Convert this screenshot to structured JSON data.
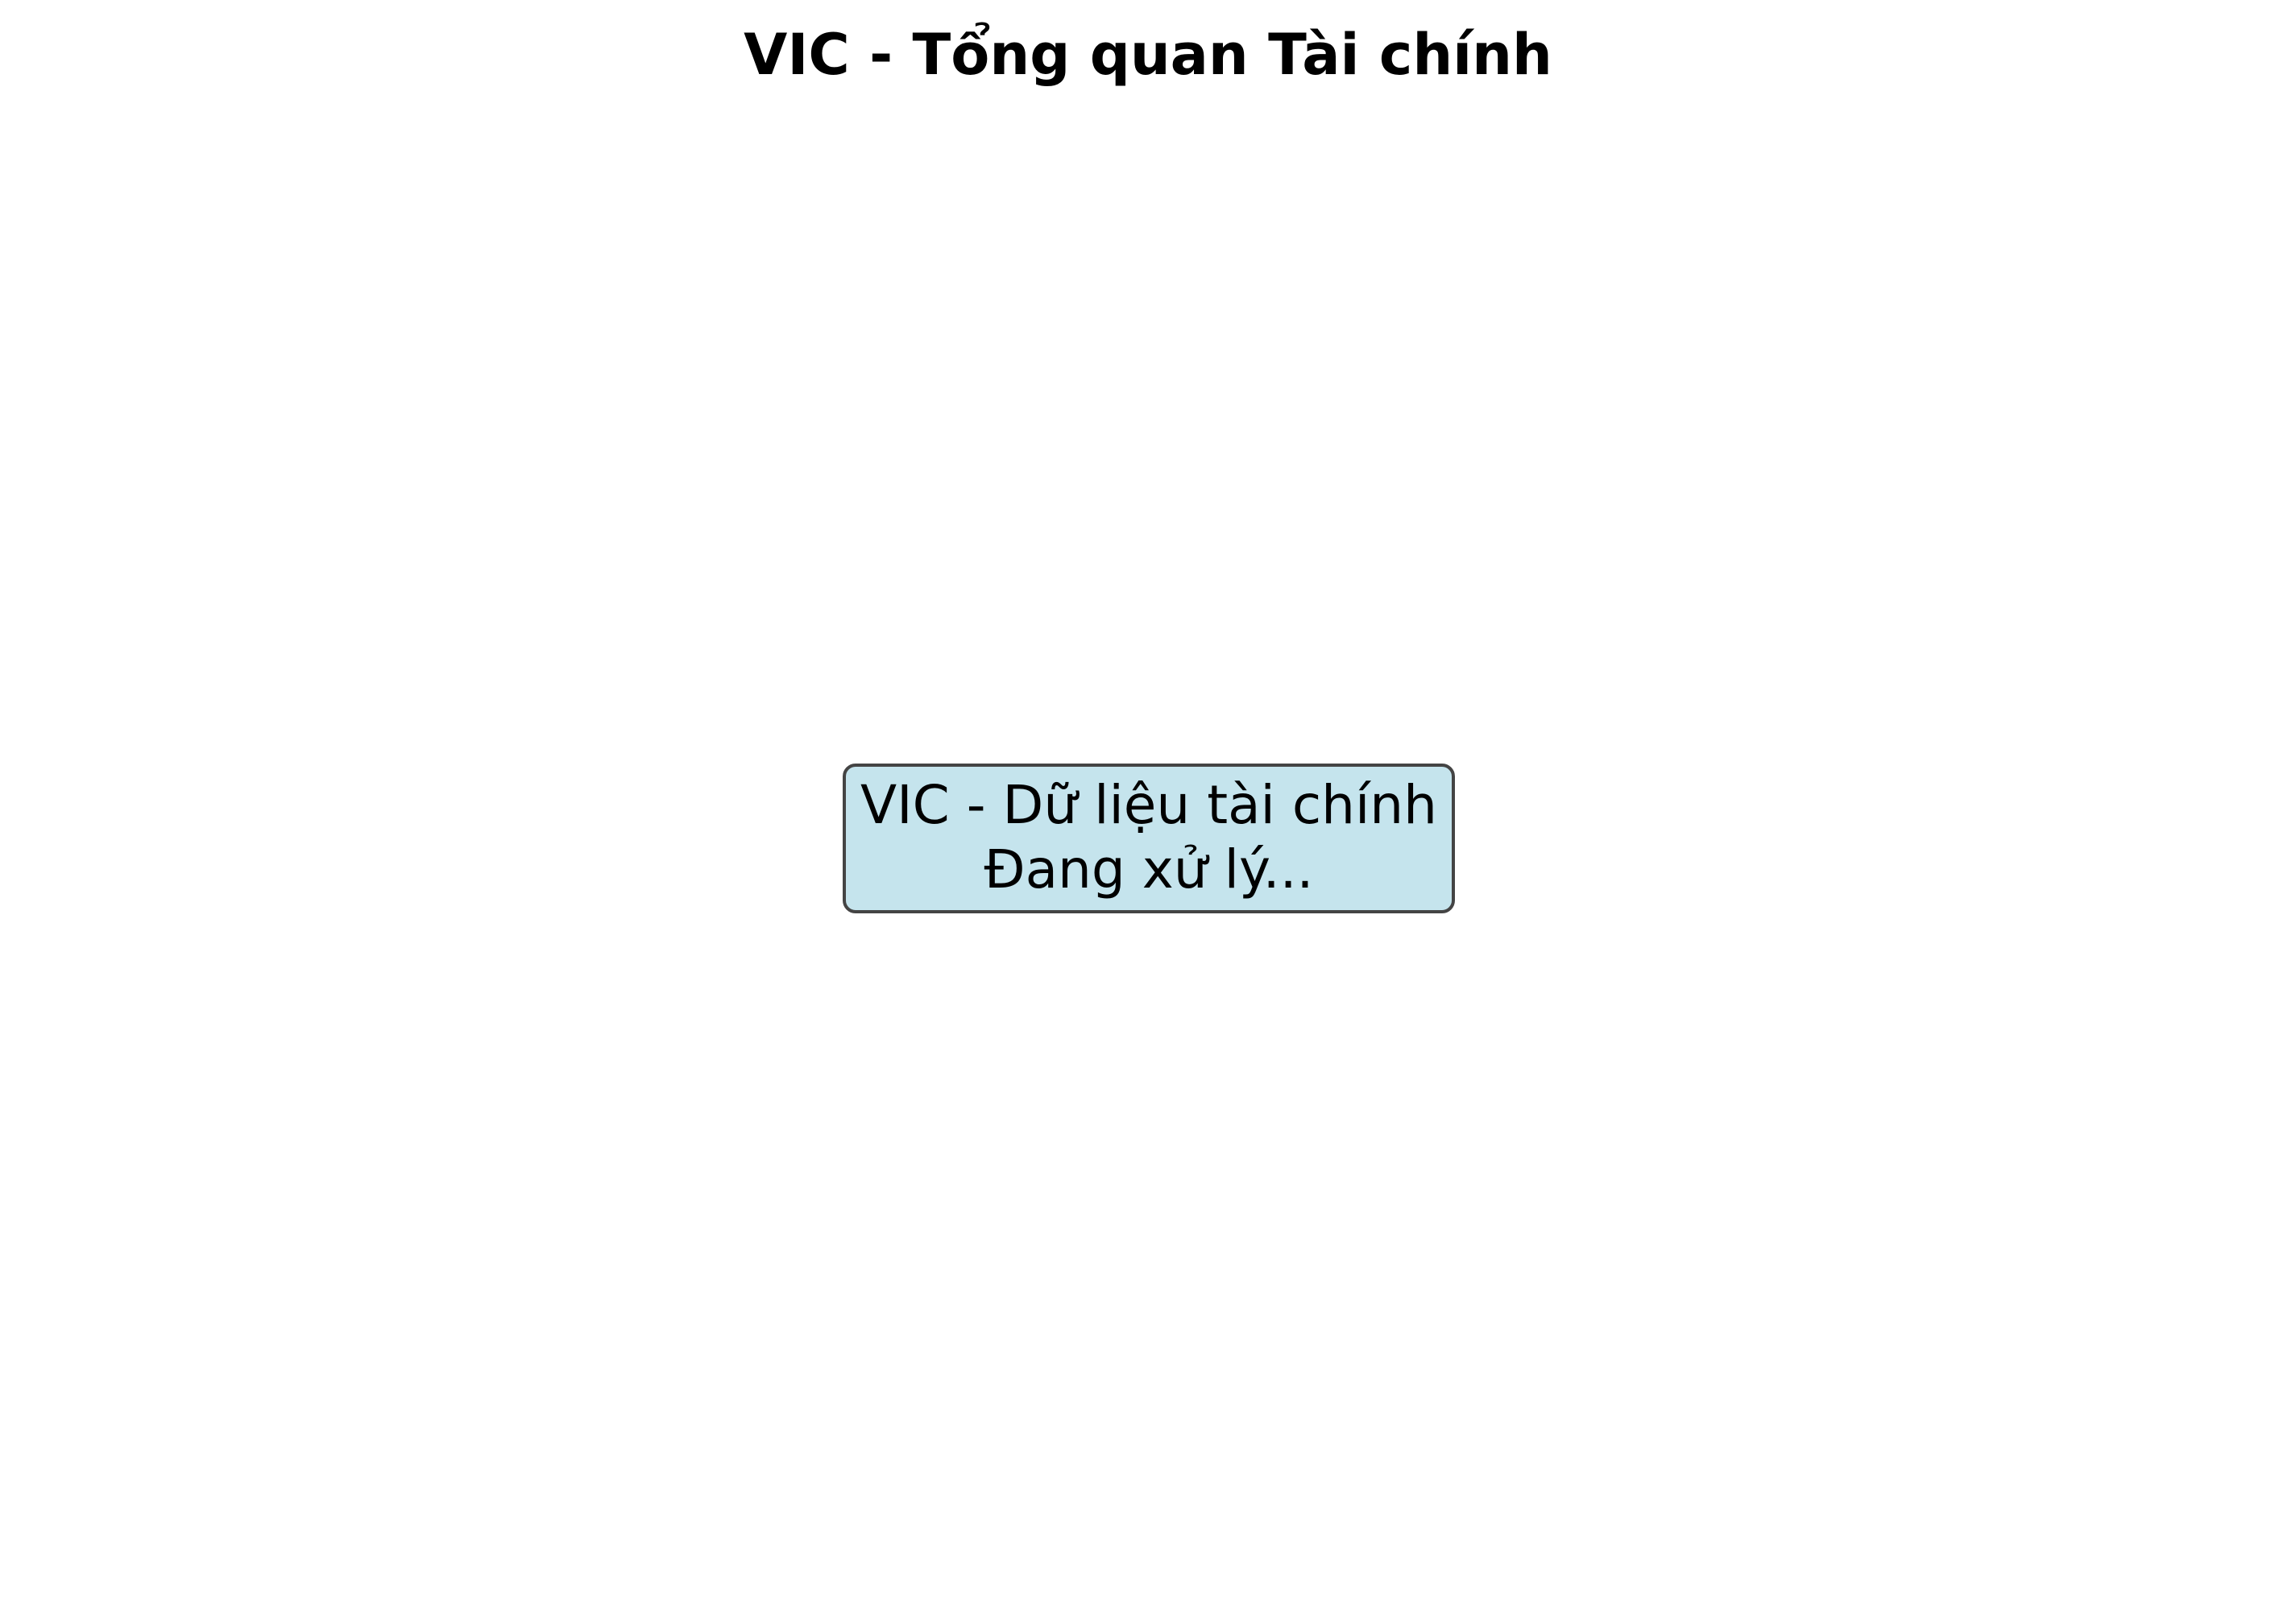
{
  "chart_data": {
    "type": "table",
    "title": "VIC - Tổng quan Tài chính",
    "xlabel": "",
    "ylabel": "",
    "grid": false,
    "message_lines": [
      "VIC - Dữ liệu tài chính",
      "Đang xử lý..."
    ],
    "box_fill_color": "#add8e6",
    "box_fill_opacity": 0.7,
    "box_edge_color": "#444444"
  }
}
